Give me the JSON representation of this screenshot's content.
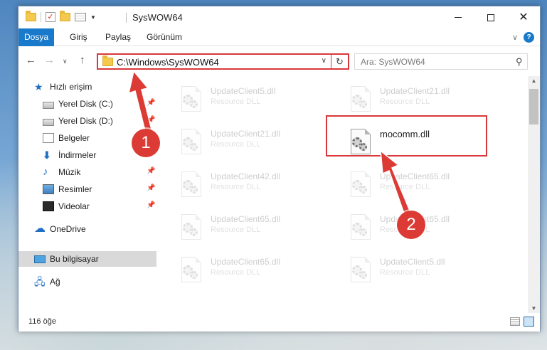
{
  "window": {
    "title": "SysWOW64",
    "controls": {
      "minimize": "—",
      "maximize": "☐",
      "close": "✕"
    }
  },
  "ribbon": {
    "tabs": [
      "Dosya",
      "Giriş",
      "Paylaş",
      "Görünüm"
    ],
    "help_label": "?"
  },
  "navigation": {
    "address": "C:\\Windows\\SysWOW64",
    "search_placeholder": "Ara: SysWOW64"
  },
  "sidebar": {
    "items": [
      {
        "label": "Hızlı erişim",
        "icon": "star-icon"
      },
      {
        "label": "Yerel Disk (C:)",
        "icon": "drive-icon",
        "pinned": true
      },
      {
        "label": "Yerel Disk (D:)",
        "icon": "drive-icon",
        "pinned": true
      },
      {
        "label": "Belgeler",
        "icon": "documents-icon",
        "pinned": true
      },
      {
        "label": "İndirmeler",
        "icon": "downloads-icon",
        "pinned": true
      },
      {
        "label": "Müzik",
        "icon": "music-icon",
        "pinned": true
      },
      {
        "label": "Resimler",
        "icon": "pictures-icon",
        "pinned": true
      },
      {
        "label": "Videolar",
        "icon": "videos-icon",
        "pinned": true
      },
      {
        "label": "OneDrive",
        "icon": "onedrive-icon"
      },
      {
        "label": "Bu bilgisayar",
        "icon": "this-pc-icon",
        "selected": true
      },
      {
        "label": "Ağ",
        "icon": "network-icon"
      }
    ]
  },
  "files": [
    {
      "name": "UpdateClient5.dll",
      "type": "Resource DLL"
    },
    {
      "name": "UpdateClient21.dll",
      "type": "Resource DLL"
    },
    {
      "name": "UpdateClient21.dll",
      "type": "Resource DLL"
    },
    {
      "name": "mocomm.dll",
      "type": "",
      "selected": true
    },
    {
      "name": "UpdateClient42.dll",
      "type": "Resource DLL"
    },
    {
      "name": "UpdateClient65.dll",
      "type": "Resource DLL"
    },
    {
      "name": "UpdateClient65.dll",
      "type": "Resource DLL"
    },
    {
      "name": "UpdateClient65.dll",
      "type": "Resource DLL"
    },
    {
      "name": "UpdateClient65.dll",
      "type": "Resource DLL"
    },
    {
      "name": "UpdateClient5.dll",
      "type": "Resource DLL"
    }
  ],
  "status": {
    "item_count": "116 öğe"
  },
  "annotations": {
    "callout_1": "1",
    "callout_2": "2"
  },
  "colors": {
    "accent": "#1979ca",
    "highlight": "#d9383a",
    "callout": "#dc3b35"
  }
}
